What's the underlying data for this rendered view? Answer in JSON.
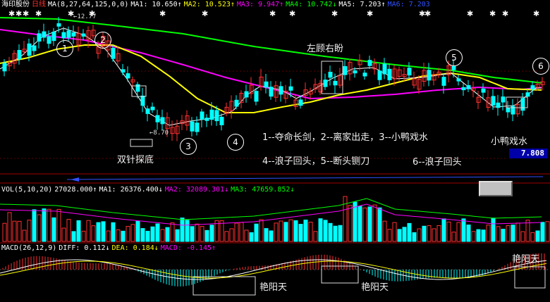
{
  "header": {
    "stock_name": "海印股份",
    "period": "日线",
    "ma_params": "MA(8,27,64,125,0,0)",
    "ma1": "MA1: 10.650↑",
    "ma2": "MA2: 10.523↑",
    "ma3": "MA3: 9.947↑",
    "ma4": "MA4: 10.742↓",
    "ma5": "MA5: 7.203↑",
    "ma6": "MA6: 7.203"
  },
  "volume": {
    "params": "VOL(5,10,20)",
    "value": "27028.000↑",
    "ma1": "MA1: 26376.400↓",
    "ma2": "MA2: 32089.301↓",
    "ma3": "MA3: 47659.852↓"
  },
  "macd": {
    "params": "MACD(26,12,9)",
    "diff": "DIFF: 0.112↓",
    "dea": "DEA: 0.184↓",
    "macd": "MACD: -0.145↑"
  },
  "price_labels": {
    "high": "12.77",
    "low": "8.70",
    "current": "7.808"
  },
  "annotations": {
    "shuangzhen": "双针探底",
    "zuogu": "左顾右盼",
    "line1": "1--夺命长剑，2--离家出走，3--小鸭戏水",
    "line2": "4--浪子回头，5--断头铡刀",
    "line3": "6--浪子回头",
    "xiaoya": "小鸭戏水",
    "yanyang1": "艳阳天",
    "yanyang2": "艳阳天",
    "yanyang3": "艳阳天"
  },
  "circles": [
    "1",
    "2",
    "3",
    "4",
    "5",
    "6"
  ],
  "colors": {
    "ma1": "#ffffff",
    "ma2": "#ffff00",
    "ma3": "#ff00ff",
    "ma4": "#00ff00",
    "ma5": "#ffffff",
    "ma6": "#0000ff",
    "up": "#ff3030",
    "down": "#00ffff"
  }
}
